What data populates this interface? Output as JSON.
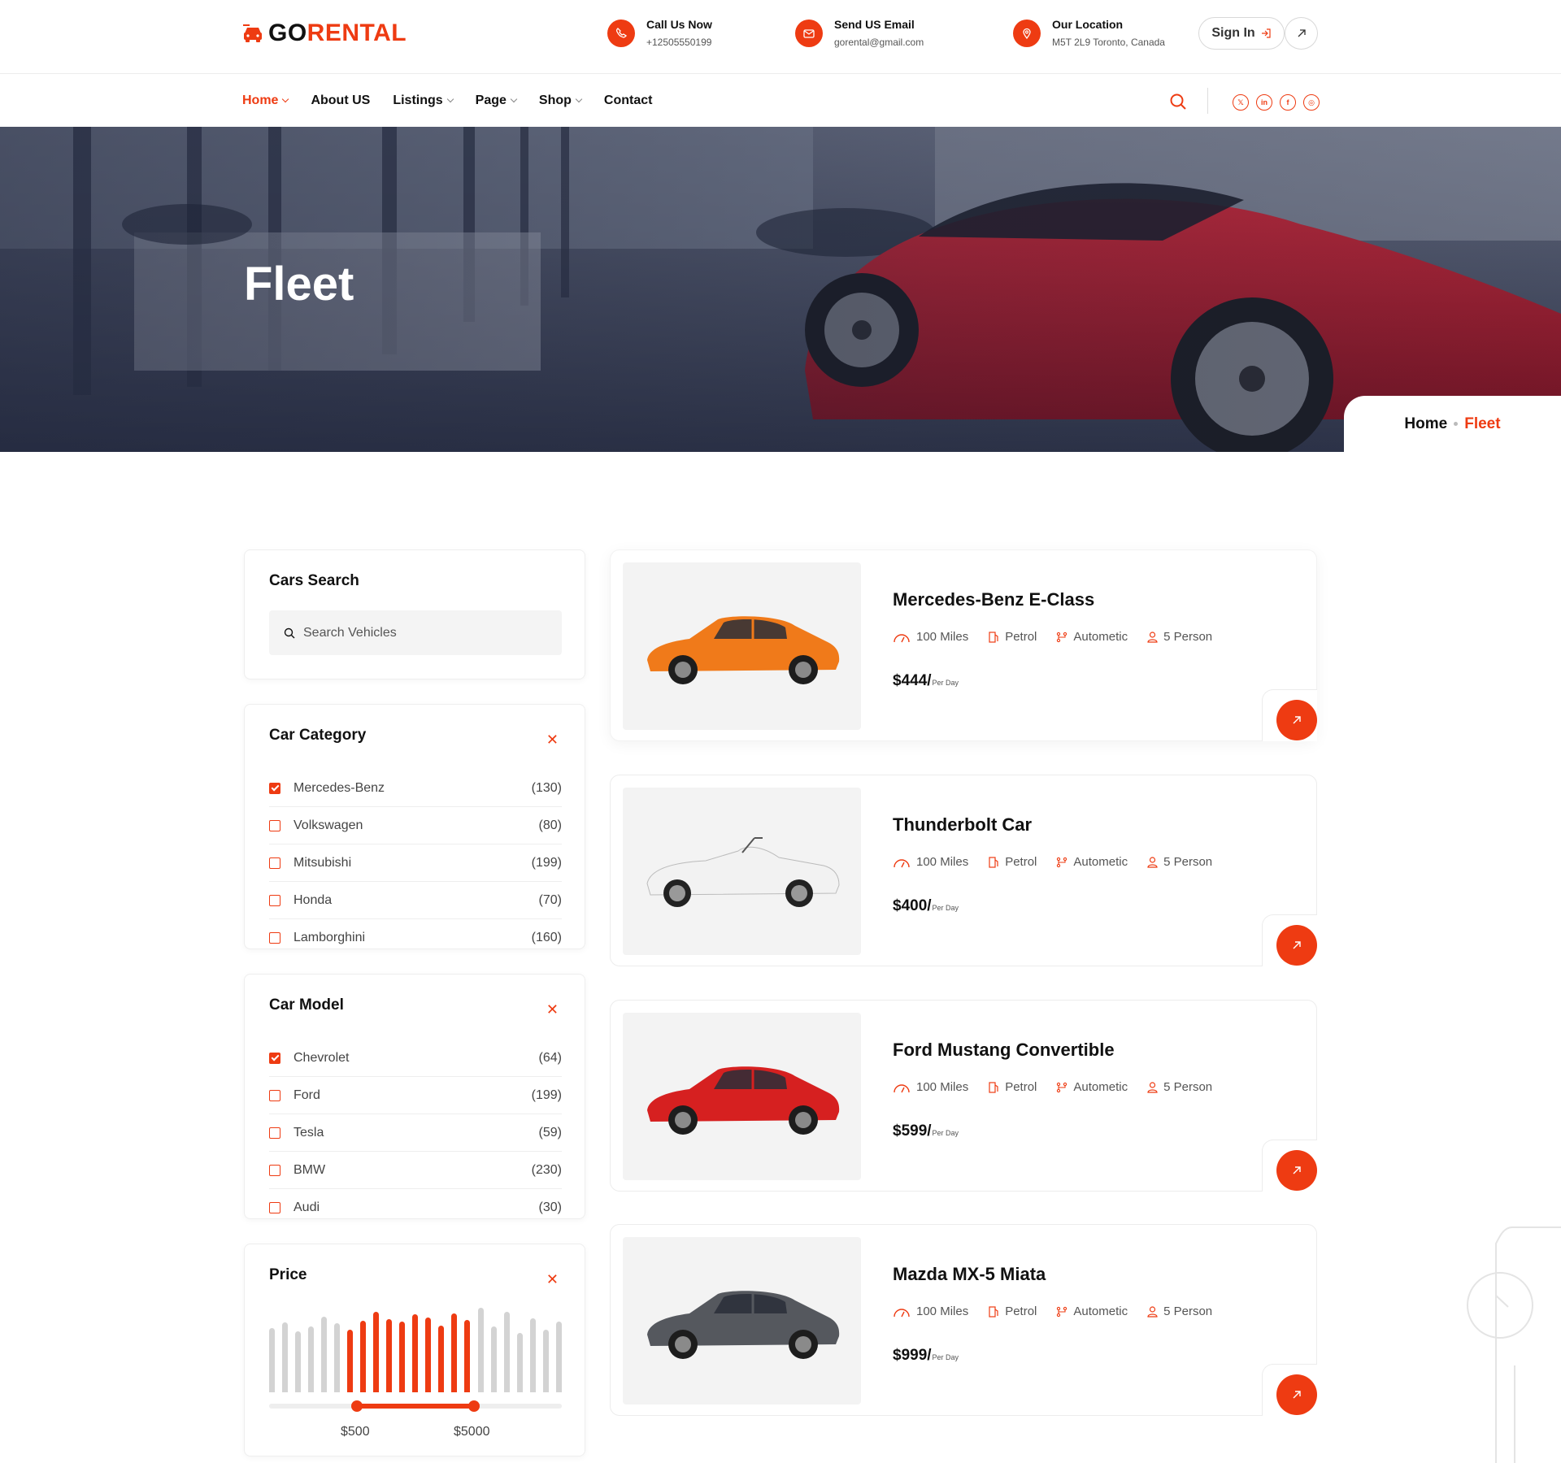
{
  "brand": {
    "logo_text_1": "GO",
    "logo_text_2": "RENTAL",
    "accent": "#ee3b12"
  },
  "header": {
    "call": {
      "title": "Call Us Now",
      "value": "+12505550199",
      "icon": "phone-icon"
    },
    "email": {
      "title": "Send US Email",
      "value": "gorental@gmail.com",
      "icon": "mail-icon"
    },
    "location": {
      "title": "Our Location",
      "value": "M5T 2L9 Toronto, Canada",
      "icon": "location-pin-icon"
    },
    "signin_label": "Sign In"
  },
  "nav": {
    "items": [
      {
        "label": "Home",
        "dropdown": true,
        "active": true
      },
      {
        "label": "About US",
        "dropdown": false
      },
      {
        "label": "Listings",
        "dropdown": true
      },
      {
        "label": "Page",
        "dropdown": true
      },
      {
        "label": "Shop",
        "dropdown": true
      },
      {
        "label": "Contact",
        "dropdown": false
      }
    ],
    "socials": [
      "x-icon",
      "linkedin-icon",
      "facebook-icon",
      "instagram-icon"
    ]
  },
  "hero": {
    "title": "Fleet"
  },
  "breadcrumb": {
    "home": "Home",
    "current": "Fleet"
  },
  "sidebar": {
    "search": {
      "title": "Cars Search",
      "placeholder": "Search Vehicles"
    },
    "category": {
      "title": "Car Category",
      "items": [
        {
          "label": "Mercedes-Benz",
          "count": "(130)",
          "checked": true
        },
        {
          "label": "Volkswagen",
          "count": "(80)",
          "checked": false
        },
        {
          "label": "Mitsubishi",
          "count": "(199)",
          "checked": false
        },
        {
          "label": "Honda",
          "count": "(70)",
          "checked": false
        },
        {
          "label": "Lamborghini",
          "count": "(160)",
          "checked": false
        }
      ]
    },
    "model": {
      "title": "Car Model",
      "items": [
        {
          "label": "Chevrolet",
          "count": "(64)",
          "checked": true
        },
        {
          "label": "Ford",
          "count": "(199)",
          "checked": false
        },
        {
          "label": "Tesla",
          "count": "(59)",
          "checked": false
        },
        {
          "label": "BMW",
          "count": "(230)",
          "checked": false
        },
        {
          "label": "Audi",
          "count": "(30)",
          "checked": false
        }
      ]
    },
    "price": {
      "title": "Price",
      "min_label": "$500",
      "max_label": "$5000",
      "bars": [
        0.72,
        0.78,
        0.68,
        0.74,
        0.85,
        0.77,
        0.7,
        0.8,
        0.9,
        0.82,
        0.79,
        0.87,
        0.84,
        0.75,
        0.88,
        0.81,
        0.95,
        0.74,
        0.9,
        0.66,
        0.83,
        0.7,
        0.79
      ],
      "bars_selected_from": 6,
      "bars_selected_to": 15,
      "range_start": 0.3,
      "range_end": 0.7
    }
  },
  "cars": [
    {
      "name": "Mercedes-Benz E-Class",
      "miles": "100 Miles",
      "fuel": "Petrol",
      "trans": "Autometic",
      "seats": "5 Person",
      "price": "$444/",
      "unit": "Per Day",
      "color": "#f07a1a"
    },
    {
      "name": "Thunderbolt Car",
      "miles": "100 Miles",
      "fuel": "Petrol",
      "trans": "Autometic",
      "seats": "5 Person",
      "price": "$400/",
      "unit": "Per Day",
      "color": "#f2f2f2"
    },
    {
      "name": "Ford Mustang Convertible",
      "miles": "100 Miles",
      "fuel": "Petrol",
      "trans": "Autometic",
      "seats": "5 Person",
      "price": "$599/",
      "unit": "Per Day",
      "color": "#d62020"
    },
    {
      "name": "Mazda MX-5 Miata",
      "miles": "100 Miles",
      "fuel": "Petrol",
      "trans": "Autometic",
      "seats": "5 Person",
      "price": "$999/",
      "unit": "Per Day",
      "color": "#55585e"
    }
  ]
}
